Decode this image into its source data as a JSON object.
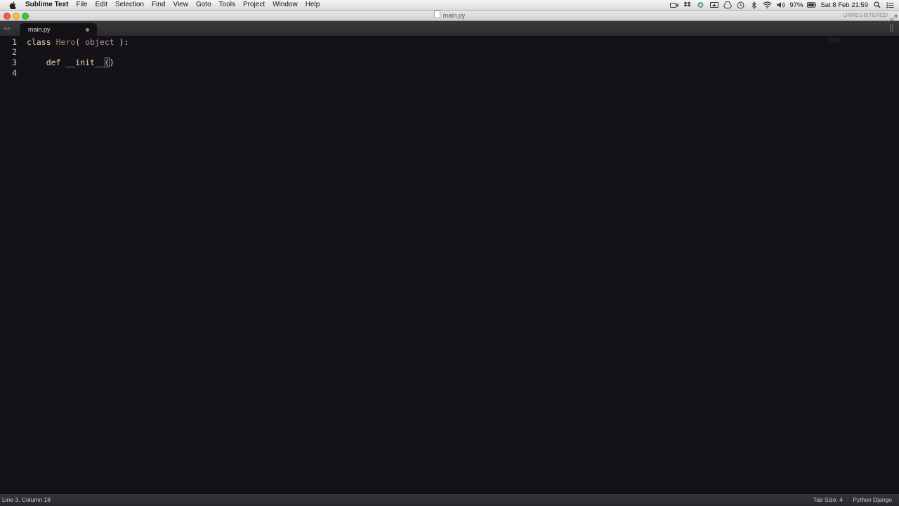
{
  "menubar": {
    "app_name": "Sublime Text",
    "items": [
      "File",
      "Edit",
      "Selection",
      "Find",
      "View",
      "Goto",
      "Tools",
      "Project",
      "Window",
      "Help"
    ],
    "status_icons": [
      "facetime-icon",
      "dropbox-icon",
      "app-icon",
      "display-icon",
      "gdrive-icon",
      "time-machine-icon",
      "bluetooth-icon",
      "wifi-icon",
      "volume-icon"
    ],
    "battery": "97%",
    "clock": "Sat 8 Feb  21:59"
  },
  "window": {
    "title": "main.py",
    "unregistered": "UNREGISTERED"
  },
  "tabs": [
    {
      "label": "main.py",
      "dirty": true
    }
  ],
  "editor": {
    "lines": [
      {
        "num": "1",
        "tokens": [
          {
            "text": "class",
            "kind": "kw"
          },
          {
            "text": " ",
            "kind": "punct"
          },
          {
            "text": "Hero",
            "kind": "cls"
          },
          {
            "text": "( ",
            "kind": "punct"
          },
          {
            "text": "object",
            "kind": "base"
          },
          {
            "text": " ):",
            "kind": "punct"
          }
        ]
      },
      {
        "num": "2",
        "tokens": []
      },
      {
        "num": "3",
        "tokens": [
          {
            "text": "    ",
            "kind": "punct"
          },
          {
            "text": "def",
            "kind": "kw"
          },
          {
            "text": " ",
            "kind": "punct"
          },
          {
            "text": "__init__",
            "kind": "fn"
          },
          {
            "text": "(",
            "kind": "punct cursor-paren"
          },
          {
            "text": ")",
            "kind": "punct"
          }
        ]
      },
      {
        "num": "4",
        "tokens": []
      }
    ]
  },
  "statusbar": {
    "position": "Line 3, Column 18",
    "tab_size": "Tab Size: 4",
    "syntax": "Python Django"
  }
}
